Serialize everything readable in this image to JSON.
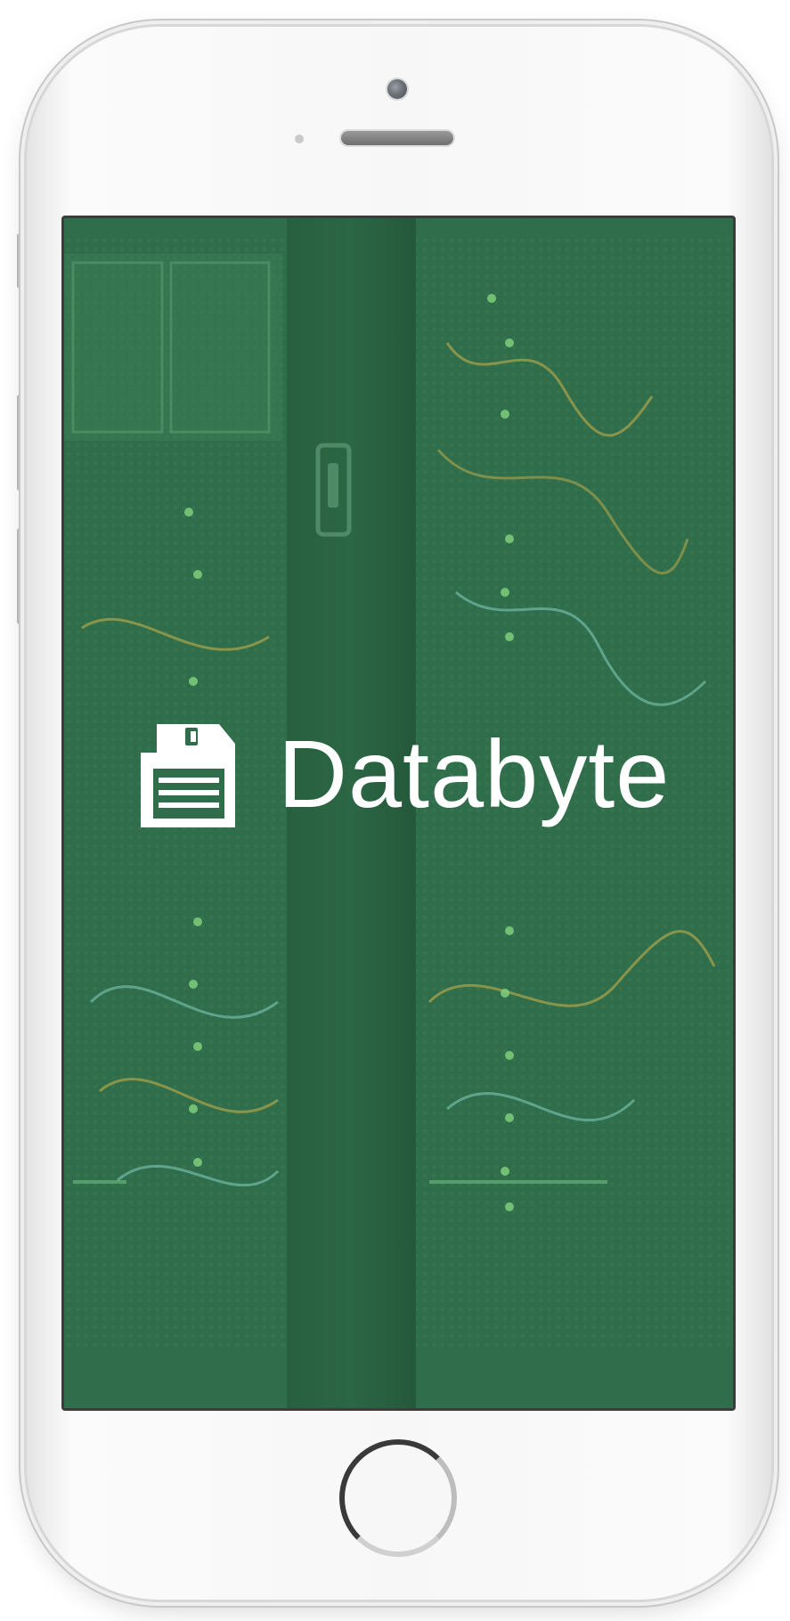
{
  "app": {
    "name": "Databyte",
    "icon": "floppy-disk-icon"
  },
  "device": {
    "type": "smartphone",
    "home_button": "home-button"
  },
  "colors": {
    "screen_background": "#2f6d4b",
    "brand_text": "#ffffff",
    "device_body": "#f7f7f7",
    "bezel": "#3c3c3c"
  },
  "screen": {
    "background_description_icon": "server-rack-image"
  }
}
